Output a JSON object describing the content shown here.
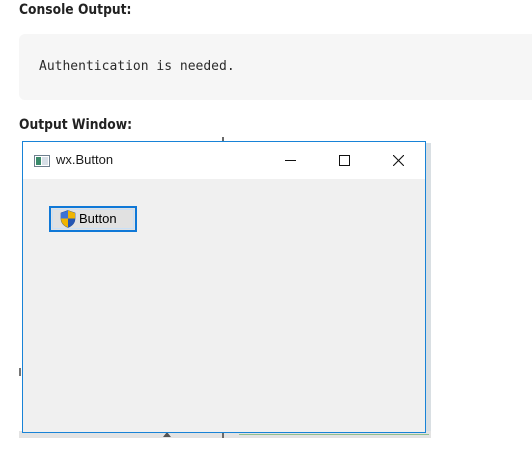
{
  "console": {
    "heading": "Console Output:",
    "text": "Authentication is needed."
  },
  "output": {
    "heading": "Output Window:"
  },
  "window": {
    "title": "wx.Button",
    "app_icon": "wx-app-icon",
    "controls": {
      "minimize": "minimize-icon",
      "maximize": "maximize-icon",
      "close": "close-icon"
    },
    "button": {
      "label": "Button",
      "icon": "uac-shield-icon"
    }
  },
  "colors": {
    "window_border": "#1883d7",
    "button_focus_border": "#0f78d7",
    "client_background": "#f0f0f0",
    "console_background": "#f6f6f6"
  }
}
